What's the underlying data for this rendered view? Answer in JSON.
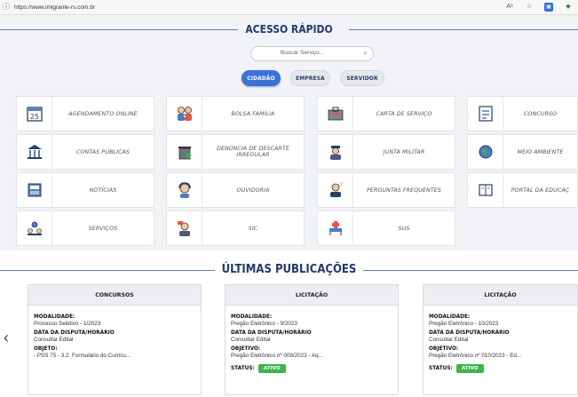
{
  "browser": {
    "url": "https://www.imigrante-rs.com.br"
  },
  "quick_access": {
    "title": "ACESSO RÁPIDO",
    "search_placeholder": "Buscar Serviço...",
    "tabs": [
      {
        "label": "CIDADÃO",
        "active": true
      },
      {
        "label": "EMPRESA",
        "active": false
      },
      {
        "label": "SERVIDOR",
        "active": false
      }
    ],
    "tiles": [
      {
        "label": "AGENDAMENTO ONLINE",
        "icon": "calendar-icon"
      },
      {
        "label": "BOLSA FAMÍLIA",
        "icon": "family-icon"
      },
      {
        "label": "CARTA DE SERVIÇO",
        "icon": "service-letter-icon"
      },
      {
        "label": "CONCURSO",
        "icon": "exam-icon"
      },
      {
        "label": "CONTAS PÚBLICAS",
        "icon": "public-accounts-icon"
      },
      {
        "label": "DENÚNCIA DE DESCARTE IRREGULAR",
        "icon": "trash-report-icon"
      },
      {
        "label": "JUNTA MILITAR",
        "icon": "military-icon"
      },
      {
        "label": "MEIO AMBIENTE",
        "icon": "environment-icon"
      },
      {
        "label": "NOTÍCIAS",
        "icon": "news-icon"
      },
      {
        "label": "OUVIDORIA",
        "icon": "ombudsman-icon"
      },
      {
        "label": "PERGUNTAS FREQUENTES",
        "icon": "faq-icon"
      },
      {
        "label": "PORTAL DA EDUCAÇ",
        "icon": "education-portal-icon"
      },
      {
        "label": "SERVIÇOS",
        "icon": "services-icon"
      },
      {
        "label": "SIC",
        "icon": "sic-icon"
      },
      {
        "label": "SUS",
        "icon": "health-icon"
      }
    ]
  },
  "publications": {
    "title": "ÚLTIMAS PUBLICAÇÕES",
    "cards": [
      {
        "category": "CONCURSOS",
        "modalidade_label": "MODALIDADE:",
        "modalidade": "Processo Seletivo - 1/2023",
        "data_label": "DATA DA DISPUTA/HORÁRIO",
        "data": "Consultar Edital",
        "objeto_label": "OBJETO:",
        "objeto": "- PSS 75 - 3.2. Formulário do Curricu...",
        "status_label": "",
        "status": ""
      },
      {
        "category": "LICITAÇÃO",
        "modalidade_label": "MODALIDADE:",
        "modalidade": "Pregão Eletrônico - 9/2023",
        "data_label": "DATA DA DISPUTA/HORÁRIO",
        "data": "Consultar Edital",
        "objeto_label": "OBJETIVO:",
        "objeto": "Pregão Eletrônico nº 009/2023 - Aq...",
        "status_label": "STATUS:",
        "status": "ATIVO"
      },
      {
        "category": "LICITAÇÃO",
        "modalidade_label": "MODALIDADE:",
        "modalidade": "Pregão Eletrônico - 10/2023",
        "data_label": "DATA DA DISPUTA/HORÁRIO",
        "data": "Consultar Edital",
        "objeto_label": "OBJETIVO:",
        "objeto": "Pregão Eletrônico nº 010/2023 - Ed...",
        "status_label": "STATUS:",
        "status": "ATIVO"
      }
    ]
  },
  "colors": {
    "accent": "#3a72d8",
    "heading": "#233a6b",
    "status_active": "#3cb44a",
    "section_bg": "#f1f3f6"
  }
}
